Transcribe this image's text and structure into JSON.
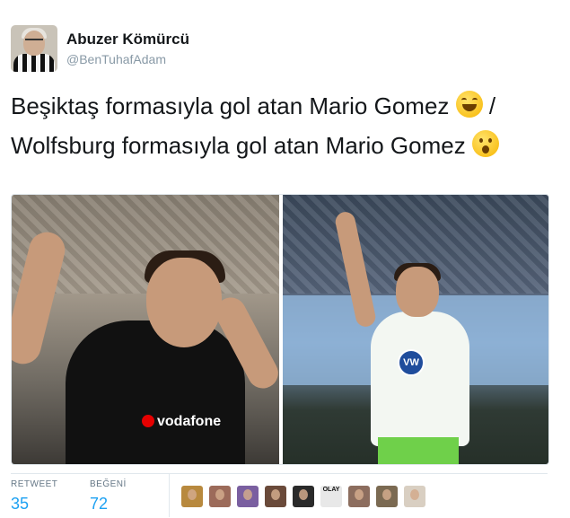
{
  "tweet": {
    "author_name": "Abuzer Kömürcü",
    "author_handle": "@BenTuhafAdam",
    "text_part1": "Beşiktaş formasıyla gol atan Mario Gomez ",
    "emoji1": "grinning-squinting-face",
    "text_part2": " / Wolfsburg formasıyla gol atan Mario Gomez ",
    "emoji2": "face-with-open-mouth"
  },
  "media": {
    "left_photo_text": "vodafone",
    "right_photo_text": "VW"
  },
  "stats": {
    "retweets_label": "RETWEET",
    "retweets_value": "35",
    "likes_label": "BEĞENİ",
    "likes_value": "72"
  },
  "likers": [
    {
      "name": "liker-avatar-1",
      "color": "#b8893e"
    },
    {
      "name": "liker-avatar-2",
      "color": "#9c6b5a"
    },
    {
      "name": "liker-avatar-3",
      "color": "#7a5fa0"
    },
    {
      "name": "liker-avatar-4",
      "color": "#6a4a3a"
    },
    {
      "name": "liker-avatar-5",
      "color": "#2a2a2a"
    },
    {
      "name": "liker-avatar-6",
      "color": "#e8e8e8",
      "text": "OLAY"
    },
    {
      "name": "liker-avatar-7",
      "color": "#8c6d5e"
    },
    {
      "name": "liker-avatar-8",
      "color": "#7b6a52"
    },
    {
      "name": "liker-avatar-9",
      "color": "#d9cfc2"
    }
  ]
}
